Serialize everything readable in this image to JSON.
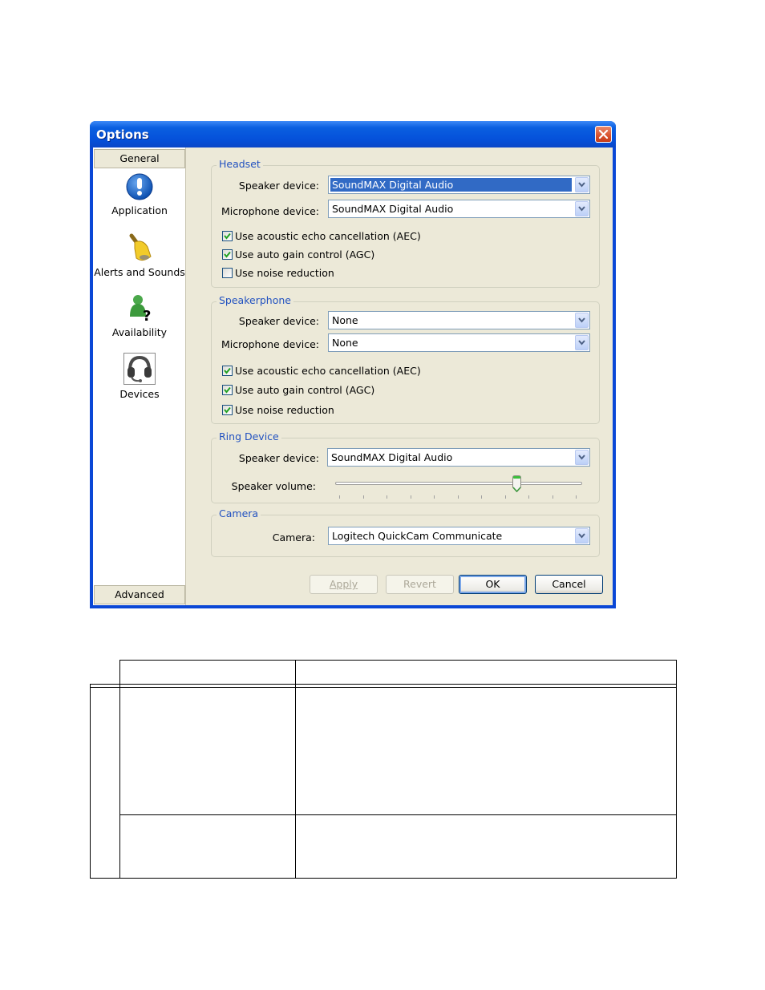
{
  "window": {
    "title": "Options",
    "close_icon": "close-icon"
  },
  "sidebar": {
    "header_top": "General",
    "header_bottom": "Advanced",
    "items": [
      {
        "label": "Application",
        "icon": "exclamation-icon"
      },
      {
        "label": "Alerts and Sounds",
        "icon": "bell-icon"
      },
      {
        "label": "Availability",
        "icon": "person-question-icon"
      },
      {
        "label": "Devices",
        "icon": "headset-icon",
        "selected": true
      }
    ]
  },
  "headset": {
    "title": "Headset",
    "speaker_label": "Speaker device:",
    "speaker_value": "SoundMAX Digital Audio",
    "microphone_label": "Microphone device:",
    "microphone_value": "SoundMAX Digital Audio",
    "checkboxes": [
      {
        "label": "Use acoustic echo cancellation (AEC)",
        "checked": true
      },
      {
        "label": "Use auto gain control (AGC)",
        "checked": true
      },
      {
        "label": "Use noise reduction",
        "checked": false
      }
    ]
  },
  "speakerphone": {
    "title": "Speakerphone",
    "speaker_label": "Speaker device:",
    "speaker_value": "None",
    "microphone_label": "Microphone device:",
    "microphone_value": "None",
    "checkboxes": [
      {
        "label": "Use acoustic echo cancellation (AEC)",
        "checked": true
      },
      {
        "label": "Use auto gain control (AGC)",
        "checked": true
      },
      {
        "label": "Use noise reduction",
        "checked": true
      }
    ]
  },
  "ring_device": {
    "title": "Ring Device",
    "speaker_label": "Speaker device:",
    "speaker_value": "SoundMAX Digital Audio",
    "volume_label": "Speaker volume:",
    "volume_fraction": 0.75,
    "tick_count": 11
  },
  "camera": {
    "title": "Camera",
    "camera_label": "Camera:",
    "camera_value": "Logitech QuickCam Communicate"
  },
  "buttons": {
    "apply": "Apply",
    "revert": "Revert",
    "ok": "OK",
    "cancel": "Cancel"
  }
}
